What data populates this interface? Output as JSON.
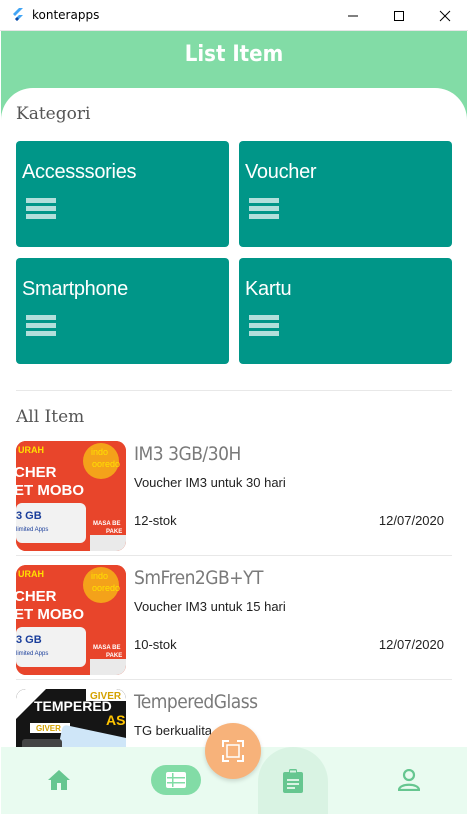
{
  "window": {
    "title": "konterapps"
  },
  "appbar": {
    "title": "List Item"
  },
  "categories": {
    "title": "Kategori",
    "items": [
      {
        "label": "Accesssories"
      },
      {
        "label": "Voucher"
      },
      {
        "label": "Smartphone"
      },
      {
        "label": "Kartu"
      }
    ]
  },
  "all_items": {
    "title": "All Item",
    "items": [
      {
        "name": "IM3 3GB/30H",
        "desc": "Voucher IM3 untuk 30 hari",
        "stock": "12-stok",
        "date": "12/07/2020",
        "thumb_text": [
          "URAH",
          "CHER",
          "ET MOBO",
          "3 GB",
          "limited Apps",
          "MASA BE",
          "PAKE",
          "indo",
          "ooredo"
        ]
      },
      {
        "name": "SmFren2GB+YT",
        "desc": "Voucher IM3 untuk 15 hari",
        "stock": "10-stok",
        "date": "12/07/2020",
        "thumb_text": [
          "URAH",
          "CHER",
          "ET MOBO",
          "3 GB",
          "limited Apps",
          "MASA BE",
          "PAKE",
          "indo",
          "ooredo"
        ]
      },
      {
        "name": "TemperedGlass",
        "desc": "TG berkualita",
        "stock": "",
        "date": "",
        "thumb_text": [
          "GIVER",
          "TEMPERED",
          "ASS",
          "GIVER"
        ]
      }
    ]
  },
  "colors": {
    "appbar": "#82dca6",
    "card": "#009688",
    "fab": "#f7b27a",
    "nav_bg": "#e9fbf0",
    "nav_icon": "#66c690"
  }
}
